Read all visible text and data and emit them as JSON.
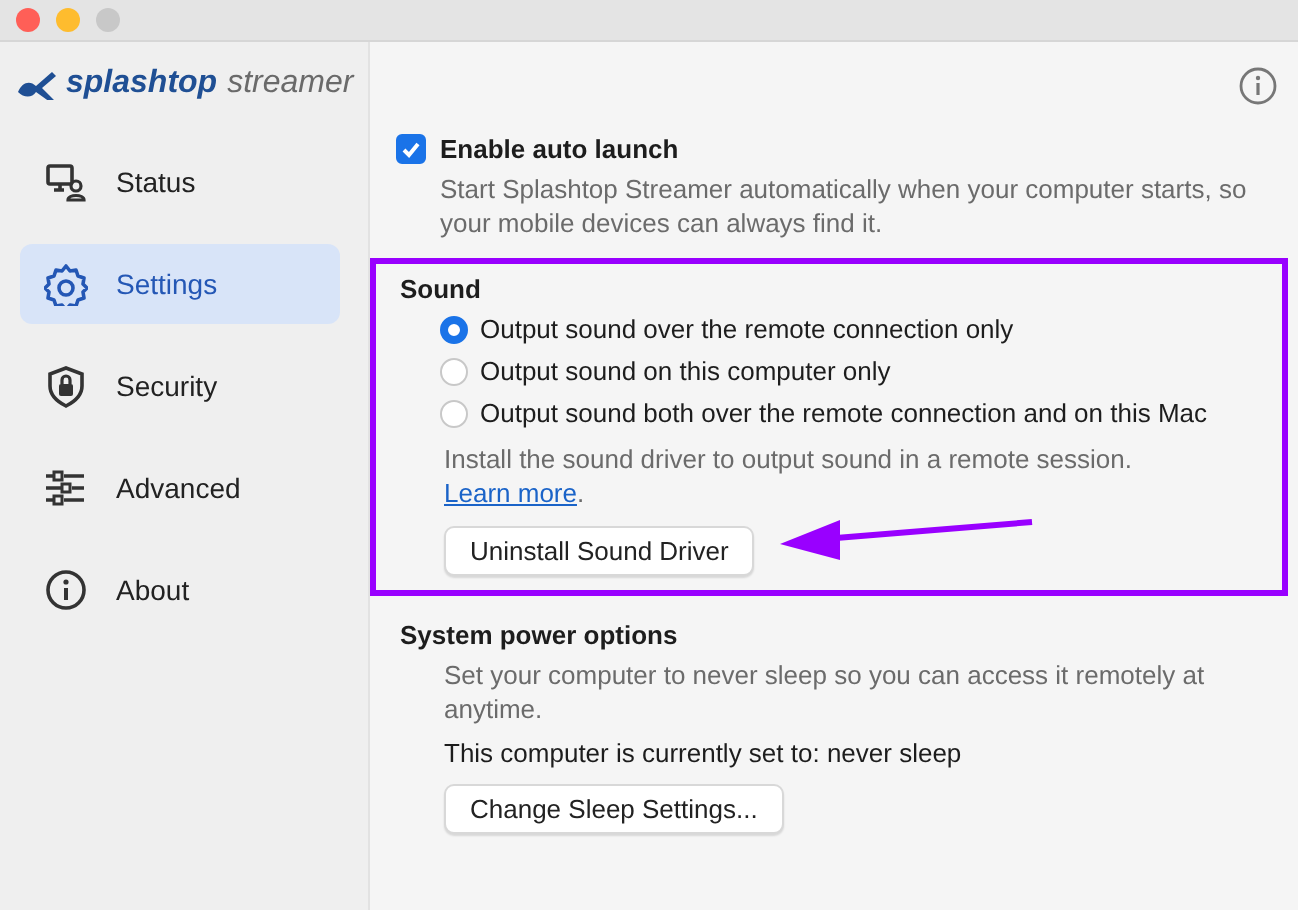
{
  "logo": {
    "brand": "splashtop",
    "product": "streamer"
  },
  "sidebar": {
    "items": [
      {
        "label": "Status",
        "selected": false
      },
      {
        "label": "Settings",
        "selected": true
      },
      {
        "label": "Security",
        "selected": false
      },
      {
        "label": "Advanced",
        "selected": false
      },
      {
        "label": "About",
        "selected": false
      }
    ]
  },
  "auto_launch": {
    "label": "Enable auto launch",
    "checked": true,
    "description": "Start Splashtop Streamer automatically when your computer starts, so your mobile devices can always find it."
  },
  "sound": {
    "title": "Sound",
    "options": [
      {
        "label": "Output sound over the remote connection only",
        "selected": true
      },
      {
        "label": "Output sound on this computer only",
        "selected": false
      },
      {
        "label": "Output sound both over the remote connection and on this Mac",
        "selected": false
      }
    ],
    "note": "Install the sound driver to output sound in a remote session.",
    "link": "Learn more",
    "note_end": ".",
    "button": "Uninstall Sound Driver"
  },
  "power": {
    "title": "System power options",
    "description": "Set your computer to never sleep so you can access it remotely at anytime.",
    "status": "This computer is currently set to: never sleep",
    "button": "Change Sleep Settings..."
  }
}
